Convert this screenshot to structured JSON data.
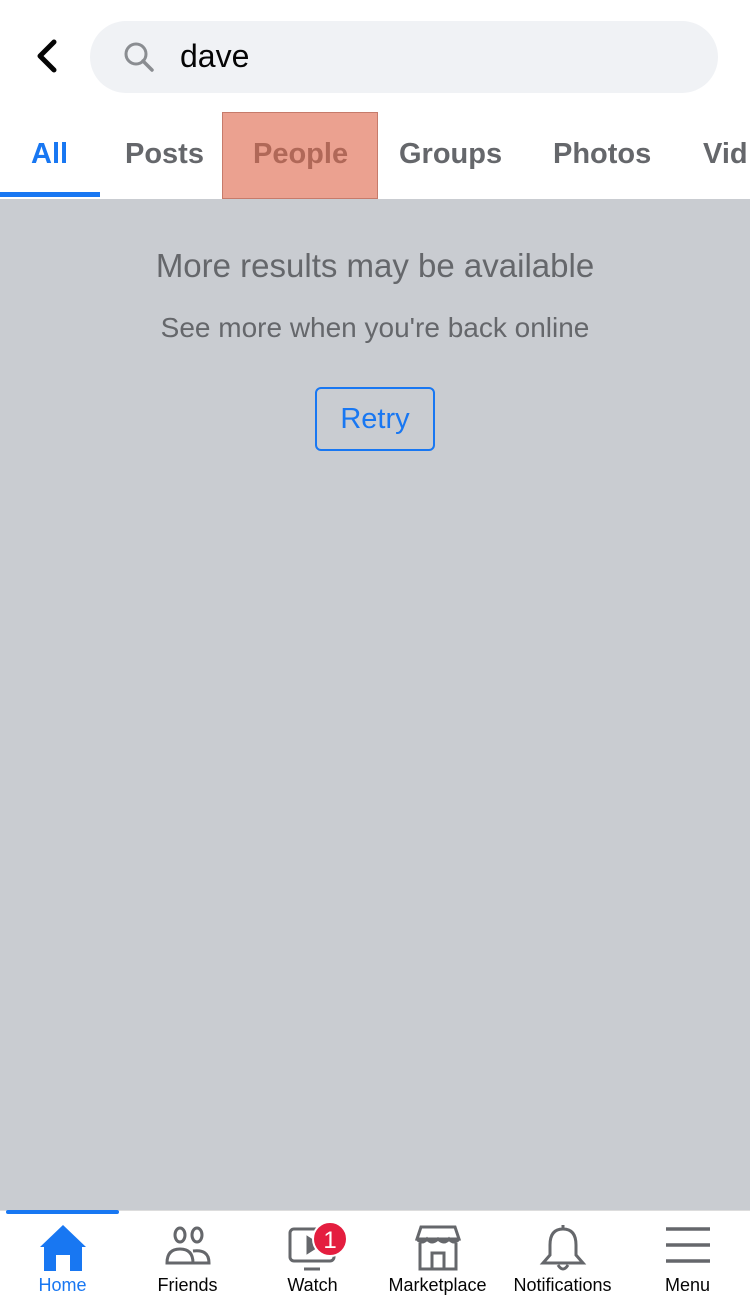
{
  "header": {
    "search_query": "dave"
  },
  "tabs": [
    {
      "label": "All",
      "active": true
    },
    {
      "label": "Posts"
    },
    {
      "label": "People"
    },
    {
      "label": "Groups"
    },
    {
      "label": "Photos"
    },
    {
      "label": "Vid"
    }
  ],
  "main": {
    "title": "More results may be available",
    "subtitle": "See more when you're back online",
    "retry_label": "Retry"
  },
  "nav": [
    {
      "label": "Home",
      "icon": "home-icon",
      "active": true
    },
    {
      "label": "Friends",
      "icon": "friends-icon"
    },
    {
      "label": "Watch",
      "icon": "watch-icon",
      "badge": "1"
    },
    {
      "label": "Marketplace",
      "icon": "marketplace-icon"
    },
    {
      "label": "Notifications",
      "icon": "bell-icon"
    },
    {
      "label": "Menu",
      "icon": "menu-icon"
    }
  ],
  "colors": {
    "accent": "#1877f2",
    "badge": "#e41e3f",
    "background": "#c9ccd1"
  }
}
